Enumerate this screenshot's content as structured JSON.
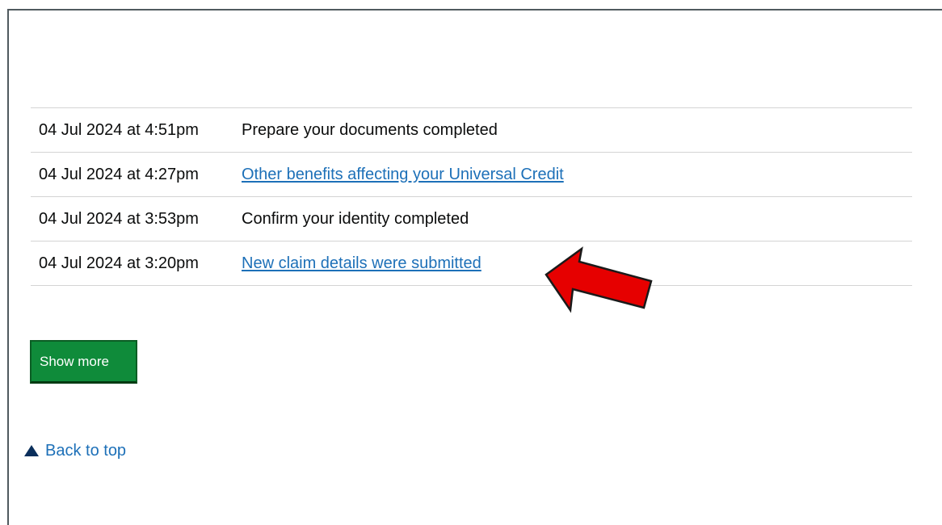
{
  "timeline": {
    "rows": [
      {
        "timestamp": "04 Jul 2024 at 4:51pm",
        "event": "Prepare your documents completed",
        "is_link": false
      },
      {
        "timestamp": "04 Jul 2024 at 4:27pm",
        "event": "Other benefits affecting your Universal Credit",
        "is_link": true
      },
      {
        "timestamp": "04 Jul 2024 at 3:53pm",
        "event": "Confirm your identity completed",
        "is_link": false
      },
      {
        "timestamp": "04 Jul 2024 at 3:20pm",
        "event": "New claim details were submitted",
        "is_link": true
      }
    ]
  },
  "actions": {
    "show_more_label": "Show more",
    "back_to_top_label": "Back to top"
  },
  "annotation": {
    "arrow_color": "#e60000",
    "icon": "red-arrow-icon"
  },
  "colors": {
    "link": "#1d70b8",
    "button": "#0f8b3a",
    "text": "#0b0c0c"
  }
}
